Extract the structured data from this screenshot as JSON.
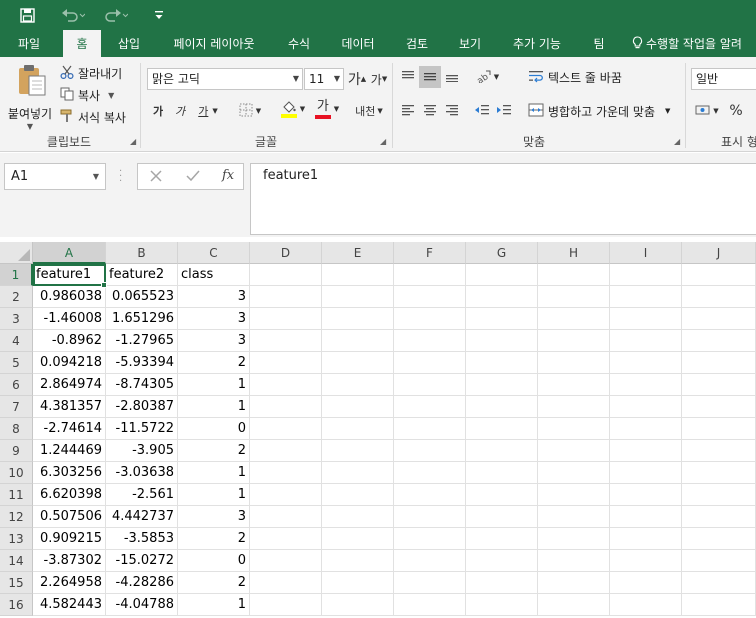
{
  "quick_access": {
    "save_icon": "save-icon",
    "undo_icon": "undo-icon",
    "redo_icon": "redo-icon",
    "customize_icon": "customize-qat-icon"
  },
  "tabs": [
    {
      "label": "파일"
    },
    {
      "label": "홈"
    },
    {
      "label": "삽입"
    },
    {
      "label": "페이지 레이아웃"
    },
    {
      "label": "수식"
    },
    {
      "label": "데이터"
    },
    {
      "label": "검토"
    },
    {
      "label": "보기"
    },
    {
      "label": "추가 기능"
    },
    {
      "label": "팀"
    }
  ],
  "active_tab": "홈",
  "tell_me": "수행할 작업을 알려",
  "ribbon": {
    "clipboard": {
      "group_label": "클립보드",
      "paste": "붙여넣기",
      "cut": "잘라내기",
      "copy": "복사",
      "format_painter": "서식 복사"
    },
    "font": {
      "group_label": "글꼴",
      "font_name": "맑은 고딕",
      "font_size": "11",
      "grow": "가",
      "shrink": "가",
      "bold": "가",
      "italic": "가",
      "underline": "가",
      "font_color_glyph": "가",
      "phonetic": "내천",
      "highlight_color": "#ffff00",
      "font_color": "#e81123"
    },
    "alignment": {
      "group_label": "맞춤",
      "wrap_text": "텍스트 줄 바꿈",
      "merge_center": "병합하고 가운데 맞춤"
    },
    "number": {
      "group_label": "표시 형",
      "format": "일반",
      "percent": "%"
    }
  },
  "formula_bar": {
    "name_box": "A1",
    "cancel_icon": "cancel-icon",
    "enter_icon": "enter-icon",
    "fx_label": "fx",
    "formula": "feature1"
  },
  "columns": [
    "A",
    "B",
    "C",
    "D",
    "E",
    "F",
    "G",
    "H",
    "I",
    "J"
  ],
  "selected_column": "A",
  "selected_row": "1",
  "rows": [
    {
      "num": "1",
      "a": "feature1",
      "b": "feature2",
      "c": "class"
    },
    {
      "num": "2",
      "a": "0.986038",
      "b": "0.065523",
      "c": "3"
    },
    {
      "num": "3",
      "a": "-1.46008",
      "b": "1.651296",
      "c": "3"
    },
    {
      "num": "4",
      "a": "-0.8962",
      "b": "-1.27965",
      "c": "3"
    },
    {
      "num": "5",
      "a": "0.094218",
      "b": "-5.93394",
      "c": "2"
    },
    {
      "num": "6",
      "a": "2.864974",
      "b": "-8.74305",
      "c": "1"
    },
    {
      "num": "7",
      "a": "4.381357",
      "b": "-2.80387",
      "c": "1"
    },
    {
      "num": "8",
      "a": "-2.74614",
      "b": "-11.5722",
      "c": "0"
    },
    {
      "num": "9",
      "a": "1.244469",
      "b": "-3.905",
      "c": "2"
    },
    {
      "num": "10",
      "a": "6.303256",
      "b": "-3.03638",
      "c": "1"
    },
    {
      "num": "11",
      "a": "6.620398",
      "b": "-2.561",
      "c": "1"
    },
    {
      "num": "12",
      "a": "0.507506",
      "b": "4.442737",
      "c": "3"
    },
    {
      "num": "13",
      "a": "0.909215",
      "b": "-3.5853",
      "c": "2"
    },
    {
      "num": "14",
      "a": "-3.87302",
      "b": "-15.0272",
      "c": "0"
    },
    {
      "num": "15",
      "a": "2.264958",
      "b": "-4.28286",
      "c": "2"
    },
    {
      "num": "16",
      "a": "4.582443",
      "b": "-4.04788",
      "c": "1"
    }
  ]
}
